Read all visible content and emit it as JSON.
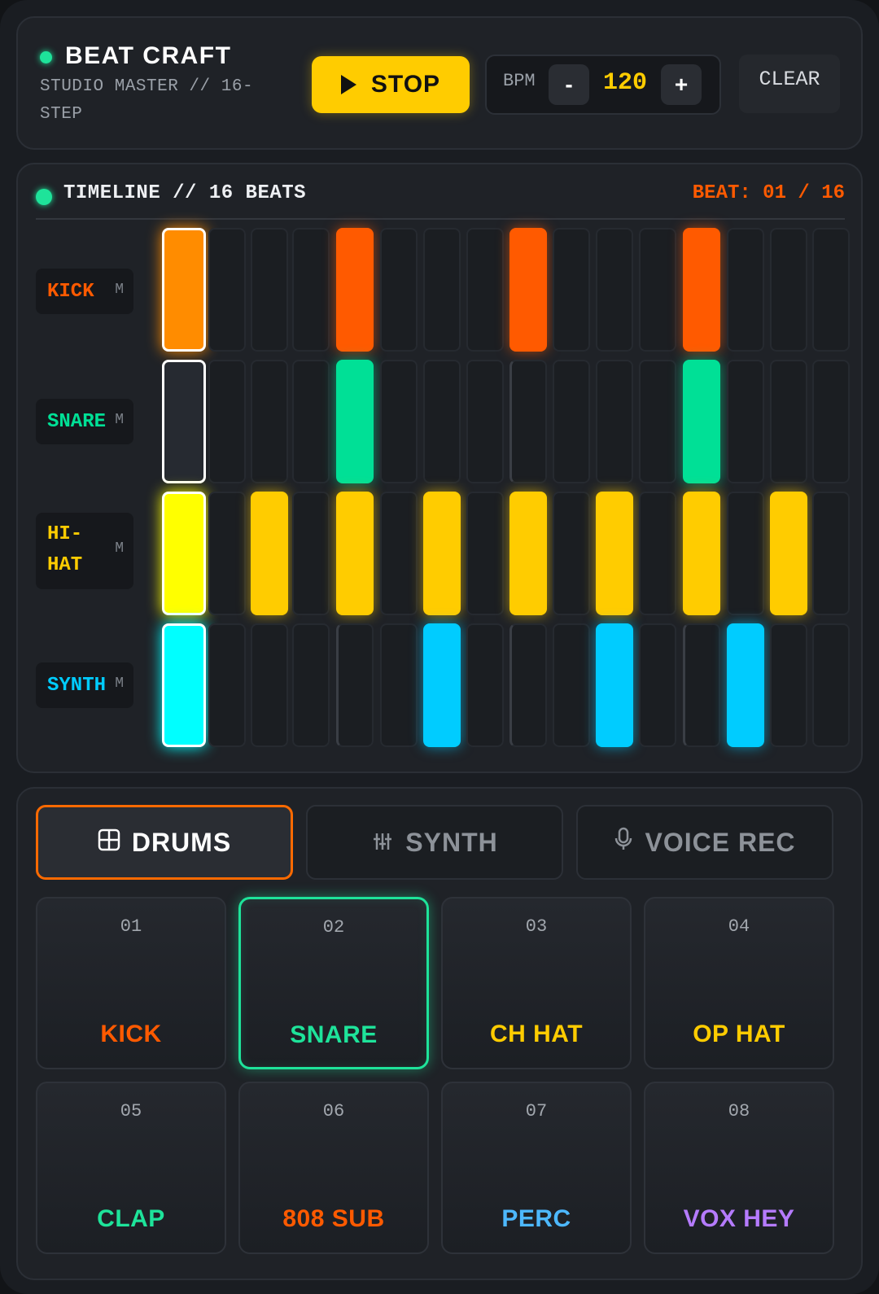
{
  "header": {
    "title": "BEAT CRAFT",
    "subtitle": "STUDIO MASTER // 16-STEP",
    "transport_label": "STOP",
    "bpm_label": "BPM",
    "bpm_value": "120",
    "bpm_decrement": "-",
    "bpm_increment": "+",
    "clear_label": "CLEAR"
  },
  "timeline": {
    "title": "TIMELINE // 16 BEATS",
    "beat_counter": "BEAT: 01 / 16",
    "current_step": 1,
    "total_steps": 16,
    "tracks": [
      {
        "name": "KICK",
        "mute": "M",
        "color": "#ff5a00",
        "active_steps": [
          1,
          5,
          9,
          13
        ]
      },
      {
        "name": "SNARE",
        "mute": "M",
        "color": "#00e096",
        "active_steps": [
          5,
          13
        ]
      },
      {
        "name": "HI-\nHAT",
        "mute": "M",
        "color": "#ffcc00",
        "active_steps": [
          1,
          3,
          5,
          7,
          9,
          11,
          13,
          15
        ]
      },
      {
        "name": "SYNTH",
        "mute": "M",
        "color": "#00ccff",
        "active_steps": [
          1,
          7,
          11,
          14
        ]
      }
    ]
  },
  "tabs": [
    {
      "label": "DRUMS",
      "icon": "grid-icon",
      "active": true
    },
    {
      "label": "SYNTH",
      "icon": "sliders-icon",
      "active": false
    },
    {
      "label": "VOICE REC",
      "icon": "microphone-icon",
      "active": false
    }
  ],
  "pads": [
    {
      "number": "01",
      "name": "KICK",
      "color": "#ff5a00"
    },
    {
      "number": "02",
      "name": "SNARE",
      "color": "#1ee39a",
      "selected": true
    },
    {
      "number": "03",
      "name": "CH HAT",
      "color": "#ffcc00"
    },
    {
      "number": "04",
      "name": "OP HAT",
      "color": "#ffcc00"
    },
    {
      "number": "05",
      "name": "CLAP",
      "color": "#1ee39a"
    },
    {
      "number": "06",
      "name": "808 SUB",
      "color": "#ff5a00"
    },
    {
      "number": "07",
      "name": "PERC",
      "color": "#4db8ff"
    },
    {
      "number": "08",
      "name": "VOX HEY",
      "color": "#b57bff"
    }
  ]
}
